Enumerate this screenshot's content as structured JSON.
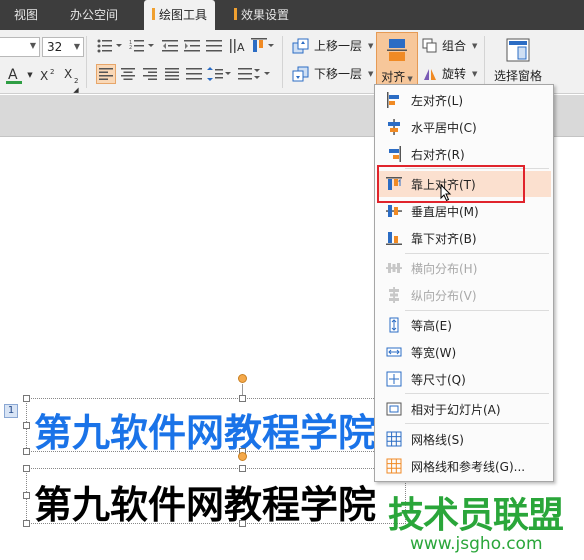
{
  "tabs": [
    {
      "label": "视图"
    },
    {
      "label": "办公空间"
    },
    {
      "label": "绘图工具"
    },
    {
      "label": "效果设置"
    }
  ],
  "ribbon": {
    "font_size": "32",
    "bring_forward": "上移一层",
    "send_backward": "下移一层",
    "align": "对齐",
    "group": "组合",
    "rotate": "旋转",
    "selection_pane": "选择窗格"
  },
  "menu": {
    "items": [
      {
        "label": "左对齐(L)",
        "icon": "align-left-icon"
      },
      {
        "label": "水平居中(C)",
        "icon": "align-center-h-icon"
      },
      {
        "label": "右对齐(R)",
        "icon": "align-right-icon"
      },
      {
        "label": "靠上对齐(T)",
        "icon": "align-top-icon"
      },
      {
        "label": "垂直居中(M)",
        "icon": "align-middle-v-icon"
      },
      {
        "label": "靠下对齐(B)",
        "icon": "align-bottom-icon"
      },
      {
        "label": "横向分布(H)",
        "icon": "distribute-h-icon"
      },
      {
        "label": "纵向分布(V)",
        "icon": "distribute-v-icon"
      },
      {
        "label": "等高(E)",
        "icon": "equal-height-icon"
      },
      {
        "label": "等宽(W)",
        "icon": "equal-width-icon"
      },
      {
        "label": "等尺寸(Q)",
        "icon": "equal-size-icon"
      },
      {
        "label": "相对于幻灯片(A)",
        "icon": "relative-slide-icon"
      },
      {
        "label": "网格线(S)",
        "icon": "grid-icon"
      },
      {
        "label": "网格线和参考线(G)...",
        "icon": "grid-guides-icon"
      }
    ]
  },
  "slide": {
    "number": "1",
    "text1": "第九软件网教程学院",
    "text2": "第九软件网教程学院"
  },
  "watermark": {
    "title": "技术员联盟",
    "url": "www.jsgho.com"
  },
  "colors": {
    "accent": "#f0a030",
    "text_blue": "#1a73e8",
    "highlight_red": "#e0242c",
    "watermark_green": "#2aa63a"
  }
}
